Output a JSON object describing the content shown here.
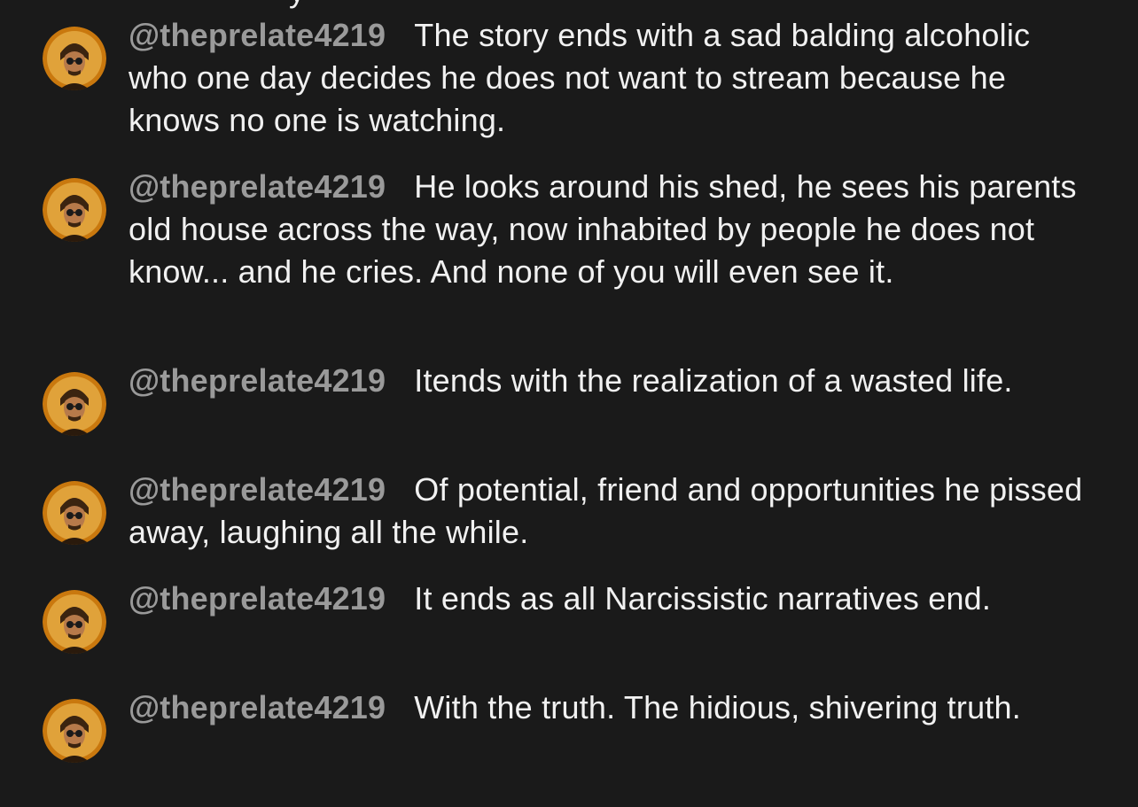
{
  "chat": {
    "partial_top_line": "y",
    "messages": [
      {
        "author": "@theprelate4219",
        "text": "The story ends with a sad balding alcoholic who one day decides he does not want to stream because he knows no one is watching."
      },
      {
        "author": "@theprelate4219",
        "text": "He looks around his shed, he sees his parents old house across the way, now inhabited by people he does not know... and he cries. And none of you will even see it."
      },
      {
        "author": "@theprelate4219",
        "text": "Itends with the realization of a wasted life."
      },
      {
        "author": "@theprelate4219",
        "text": "Of potential, friend and opportunities he pissed away, laughing all the while."
      },
      {
        "author": "@theprelate4219",
        "text": "It ends as all Narcissistic narratives end."
      },
      {
        "author": "@theprelate4219",
        "text": "With the truth. The hidious, shivering truth."
      }
    ]
  },
  "colors": {
    "background": "#1a1a1a",
    "author": "#9a9a9a",
    "message_text": "#f1f1f1",
    "avatar_ring": "#c9780e"
  },
  "icons": {
    "avatar": "user-avatar-icon"
  }
}
